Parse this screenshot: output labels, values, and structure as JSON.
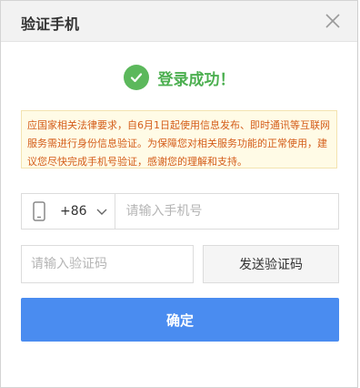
{
  "dialog": {
    "title": "验证手机",
    "close_icon": "close-icon"
  },
  "status": {
    "message": "登录成功！",
    "icon": "check-circle-icon",
    "color": "#5cb85c"
  },
  "notice": {
    "text": "应国家相关法律要求，自6月1日起使用信息发布、即时通讯等互联网服务需进行身份信息验证。为保障您对相关服务功能的正常使用，建议您尽快完成手机号验证，感谢您的理解和支持。"
  },
  "form": {
    "country_code": "+86",
    "phone_placeholder": "请输入手机号",
    "code_placeholder": "请输入验证码",
    "send_code_label": "发送验证码",
    "confirm_label": "确定"
  },
  "colors": {
    "primary": "#4a8cf0",
    "notice_text": "#d45d1a",
    "notice_bg": "#fffbe6"
  }
}
